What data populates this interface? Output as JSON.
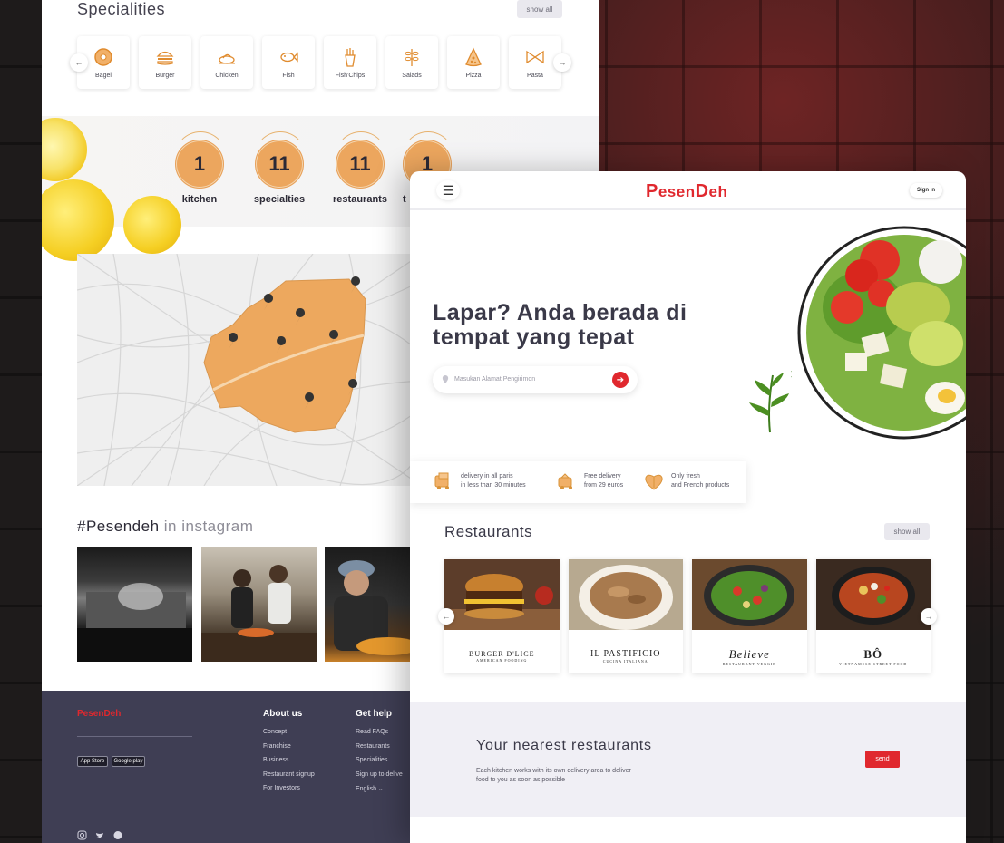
{
  "back_page": {
    "specialities_title": "Specialities",
    "show_all": "show all",
    "specialities": [
      {
        "label": "Bagel",
        "icon": "bagel-icon"
      },
      {
        "label": "Burger",
        "icon": "burger-icon"
      },
      {
        "label": "Chicken",
        "icon": "chicken-icon"
      },
      {
        "label": "Fish",
        "icon": "fish-icon"
      },
      {
        "label": "Fish'Chips",
        "icon": "fish-chips-icon"
      },
      {
        "label": "Salads",
        "icon": "salads-icon"
      },
      {
        "label": "Pizza",
        "icon": "pizza-icon"
      },
      {
        "label": "Pasta",
        "icon": "pasta-icon"
      }
    ],
    "stats": [
      {
        "value": "1",
        "label": "kitchen"
      },
      {
        "value": "11",
        "label": "specialties"
      },
      {
        "value": "11",
        "label": "restaurants"
      },
      {
        "value": "1",
        "label": "t"
      }
    ],
    "instagram_tag": "#Pesendeh",
    "instagram_suffix": "in instagram",
    "footer": {
      "logo": "PesenDeh",
      "app_store": "App Store",
      "google_play": "Google play",
      "about_title": "About us",
      "about_links": [
        "Concept",
        "Franchise",
        "Business",
        "Restaurant signup",
        "For Investors"
      ],
      "help_title": "Get help",
      "help_links": [
        "Read FAQs",
        "Restaurants",
        "Specialities",
        "Sign up to delive",
        "English ⌄"
      ]
    }
  },
  "front_page": {
    "brand_first": "P",
    "brand_mid": "esen",
    "brand_d": "D",
    "brand_end": "eh",
    "sign_in": "Sign in",
    "hero_title": "Lapar? Anda berada di tempat yang tepat",
    "search_placeholder": "Masukan Alamat Pengirimon",
    "features": [
      {
        "line1": "delivery in all paris",
        "line2": "in less than 30 minutes",
        "icon": "delivery-icon"
      },
      {
        "line1": "Free delivery",
        "line2": "from 29 euros",
        "icon": "free-delivery-icon"
      },
      {
        "line1": "Only fresh",
        "line2": "and French products",
        "icon": "heart-leaf-icon"
      }
    ],
    "restaurants_title": "Restaurants",
    "show_all": "show all",
    "restaurants": [
      {
        "name": "BURGER D'LICE",
        "sub": "AMERICAN FOODING"
      },
      {
        "name": "IL PASTIFICIO",
        "sub": "CUCINA ITALIANA"
      },
      {
        "name": "Believe",
        "sub": "RESTAURANT VEGGIE"
      },
      {
        "name": "BÔ",
        "sub": "VIETNAMESE STREET FOOD"
      }
    ],
    "nearest_title": "Your nearest restaurants",
    "nearest_text": "Each kitchen works with its own delivery area to deliver food to you as soon as possible",
    "send": "send"
  },
  "colors": {
    "brand_red": "#e0282e",
    "accent_orange": "#eca65e",
    "footer_bg": "#3f3e54",
    "text_dark": "#3a3948"
  }
}
